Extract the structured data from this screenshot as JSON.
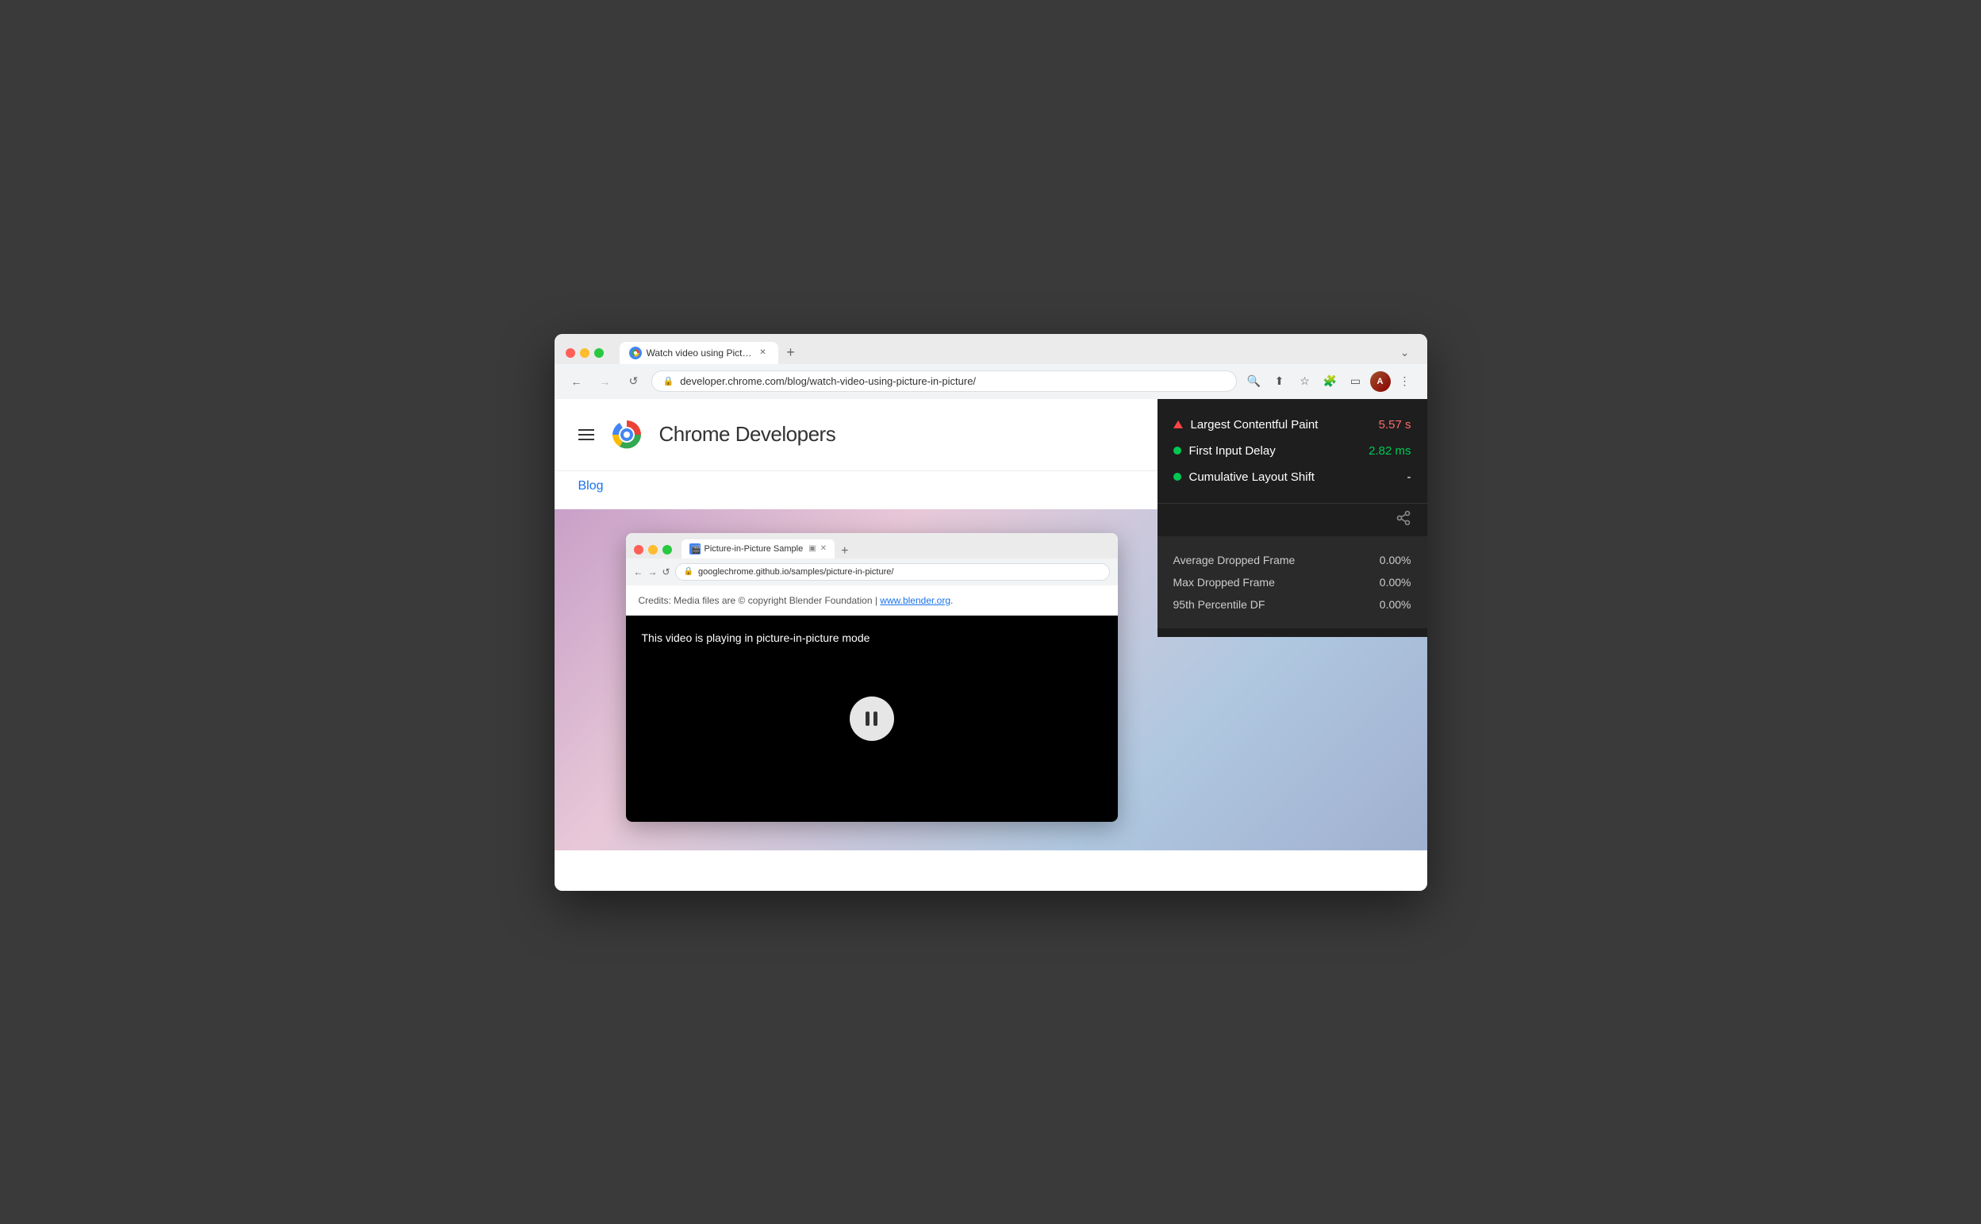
{
  "browser": {
    "tab_label": "Watch video using Picture-in-P",
    "tab_favicon": "chrome",
    "new_tab_label": "+",
    "dropdown_label": "⌄",
    "address": "developer.chrome.com/blog/watch-video-using-picture-in-picture/",
    "back_disabled": false,
    "forward_disabled": true
  },
  "site": {
    "title": "Chrome Developers",
    "blog_link": "Blog"
  },
  "inner_browser": {
    "tab_label": "Picture-in-Picture Sample",
    "address": "googlechrome.github.io/samples/picture-in-picture/",
    "credits_text": "Credits: Media files are © copyright Blender Foundation | ",
    "credits_link_text": "www.blender.org",
    "credits_link_suffix": ".",
    "video_text": "This video is playing in picture-in-picture mode"
  },
  "performance_overlay": {
    "vitals": [
      {
        "name": "Largest Contentful Paint",
        "value": "5.57 s",
        "value_color": "red",
        "indicator": "triangle-red"
      },
      {
        "name": "First Input Delay",
        "value": "2.82 ms",
        "value_color": "green",
        "indicator": "circle-green"
      },
      {
        "name": "Cumulative Layout Shift",
        "value": "-",
        "value_color": "white",
        "indicator": "circle-green"
      }
    ],
    "frames": [
      {
        "label": "Average Dropped Frame",
        "value": "0.00%"
      },
      {
        "label": "Max Dropped Frame",
        "value": "0.00%"
      },
      {
        "label": "95th Percentile DF",
        "value": "0.00%"
      }
    ],
    "share_icon": "⋮"
  }
}
